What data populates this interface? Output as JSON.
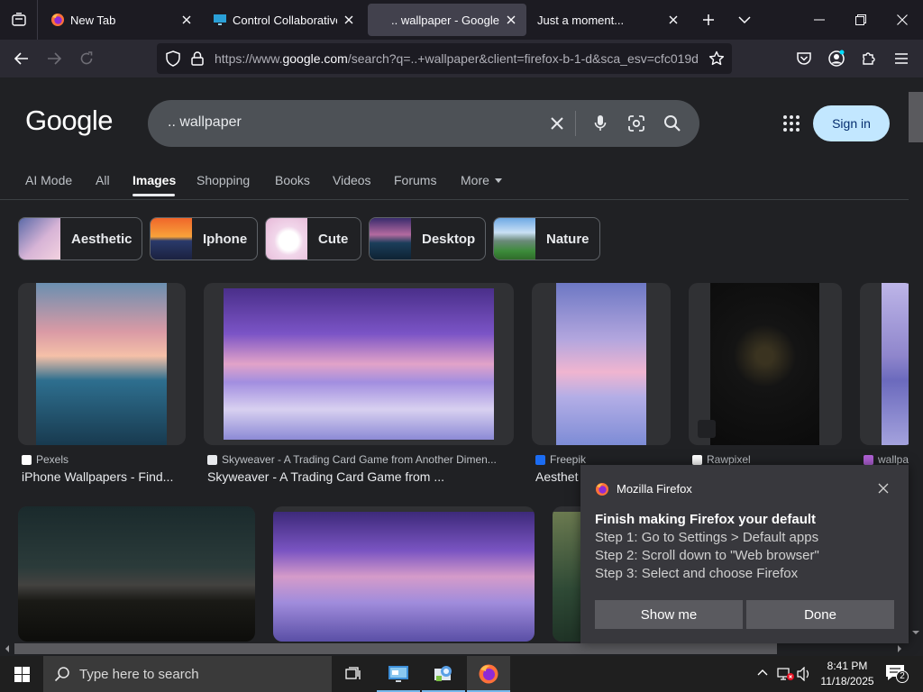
{
  "browser": {
    "tabs": [
      {
        "title": "New Tab",
        "icon": "firefox-icon",
        "active": false
      },
      {
        "title": "Control Collaborative V",
        "icon": "monitor-icon",
        "active": false
      },
      {
        "title": ".. wallpaper - Google Se",
        "icon": "google-icon",
        "active": true
      },
      {
        "title": "Just a moment...",
        "icon": "",
        "active": false
      }
    ],
    "url_prefix": "https://www.",
    "url_domain": "google.com",
    "url_rest": "/search?q=..+wallpaper&client=firefox-b-1-d&sca_esv=cfc019d"
  },
  "google": {
    "logo": "Google",
    "query": ".. wallpaper",
    "signin_label": "Sign in",
    "filters": [
      "AI Mode",
      "All",
      "Images",
      "Shopping",
      "Books",
      "Videos",
      "Forums",
      "More"
    ],
    "active_filter": "Images",
    "chips": [
      "Aesthetic",
      "Iphone",
      "Cute",
      "Desktop",
      "Nature"
    ],
    "results": [
      {
        "source": "Pexels",
        "title": "iPhone Wallpapers - Find..."
      },
      {
        "source": "Skyweaver - A Trading Card Game from Another Dimen...",
        "title": "Skyweaver - A Trading Card Game from ..."
      },
      {
        "source": "Freepik",
        "title": "Aesthet"
      },
      {
        "source": "Rawpixel",
        "title": ""
      },
      {
        "source": "wallpa",
        "title": ""
      }
    ]
  },
  "notification": {
    "app": "Mozilla Firefox",
    "heading": "Finish making Firefox your default",
    "steps": [
      "Step 1: Go to Settings > Default apps",
      "Step 2: Scroll down to \"Web browser\"",
      "Step 3: Select and choose Firefox"
    ],
    "show_me": "Show me",
    "done": "Done"
  },
  "taskbar": {
    "search_placeholder": "Type here to search",
    "time": "8:41 PM",
    "date": "11/18/2025",
    "notification_count": "2"
  },
  "colors": {
    "accent_signin": "#c2e7ff",
    "page_bg": "#202124"
  }
}
